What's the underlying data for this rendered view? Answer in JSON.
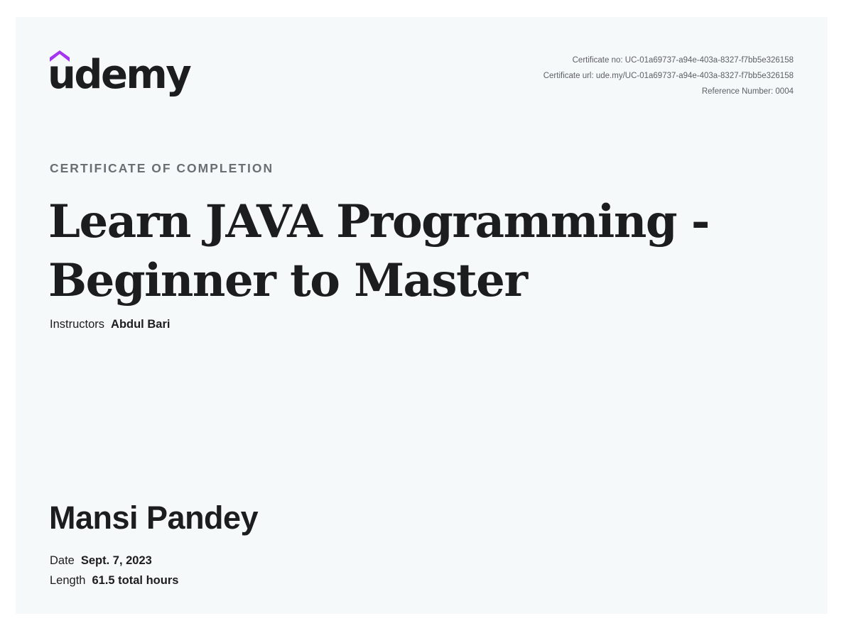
{
  "brand": {
    "logo_text": "udemy",
    "accent_color": "#a435f0"
  },
  "meta": {
    "certificate_no": "Certificate no: UC-01a69737-a94e-403a-8327-f7bb5e326158",
    "certificate_url": "Certificate url: ude.my/UC-01a69737-a94e-403a-8327-f7bb5e326158",
    "reference_number": "Reference Number: 0004"
  },
  "certificate": {
    "label": "CERTIFICATE OF COMPLETION",
    "course_title": "Learn JAVA Programming - Beginner to Master",
    "instructors_label": "Instructors",
    "instructor_name": "Abdul Bari",
    "student_name": "Mansi Pandey",
    "date_label": "Date",
    "date_value": "Sept. 7, 2023",
    "length_label": "Length",
    "length_value": "61.5 total hours"
  }
}
